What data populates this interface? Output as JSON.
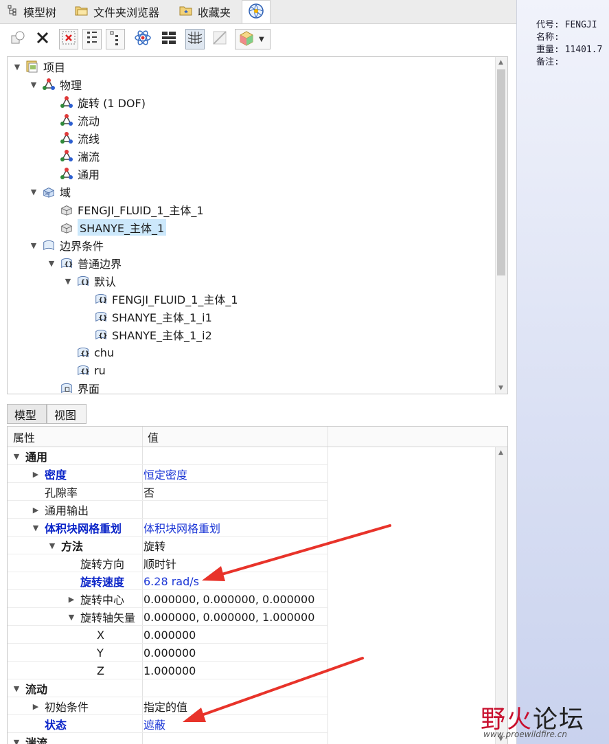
{
  "tabs": [
    {
      "label": "模型树",
      "icon": "model-tree-icon"
    },
    {
      "label": "文件夹浏览器",
      "icon": "folder-browser-icon"
    },
    {
      "label": "收藏夹",
      "icon": "favorites-icon"
    },
    {
      "label": "",
      "icon": "flow-analysis-icon"
    }
  ],
  "tree": {
    "nodes": [
      {
        "label": "项目",
        "icon": "project-icon"
      },
      {
        "label": "物理",
        "icon": "physics-icon"
      },
      {
        "label": "旋转 (1 DOF)",
        "icon": "physics-icon"
      },
      {
        "label": "流动",
        "icon": "physics-icon"
      },
      {
        "label": "流线",
        "icon": "physics-icon"
      },
      {
        "label": "湍流",
        "icon": "physics-icon"
      },
      {
        "label": "通用",
        "icon": "physics-icon"
      },
      {
        "label": "域",
        "icon": "domain-icon"
      },
      {
        "label": "FENGJI_FLUID_1_主体_1",
        "icon": "body-icon"
      },
      {
        "label": "SHANYE_主体_1",
        "icon": "body-icon"
      },
      {
        "label": "边界条件",
        "icon": "boundary-icon"
      },
      {
        "label": "普通边界",
        "icon": "boundary-icon"
      },
      {
        "label": "默认",
        "icon": "boundary-icon"
      },
      {
        "label": "FENGJI_FLUID_1_主体_1",
        "icon": "boundary-icon"
      },
      {
        "label": "SHANYE_主体_1_i1",
        "icon": "boundary-icon"
      },
      {
        "label": "SHANYE_主体_1_i2",
        "icon": "boundary-icon"
      },
      {
        "label": "chu",
        "icon": "boundary-icon"
      },
      {
        "label": "ru",
        "icon": "boundary-icon"
      },
      {
        "label": "界面",
        "icon": "interface-icon"
      }
    ]
  },
  "panel_tabs": [
    "模型",
    "视图"
  ],
  "grid": {
    "headers": {
      "property": "属性",
      "value": "值"
    },
    "rows": [
      {
        "key": "通用",
        "value": ""
      },
      {
        "key": "密度",
        "value": "恒定密度"
      },
      {
        "key": "孔隙率",
        "value": "否"
      },
      {
        "key": "通用输出",
        "value": ""
      },
      {
        "key": "体积块网格重划",
        "value": "体积块网格重划"
      },
      {
        "key": "方法",
        "value": "旋转"
      },
      {
        "key": "旋转方向",
        "value": "顺时针"
      },
      {
        "key": "旋转速度",
        "value": "6.28 rad/s"
      },
      {
        "key": "旋转中心",
        "value": "0.000000, 0.000000, 0.000000"
      },
      {
        "key": "旋转轴矢量",
        "value": "0.000000, 0.000000, 1.000000"
      },
      {
        "key": "X",
        "value": "0.000000"
      },
      {
        "key": "Y",
        "value": "0.000000"
      },
      {
        "key": "Z",
        "value": "1.000000"
      },
      {
        "key": "流动",
        "value": ""
      },
      {
        "key": "初始条件",
        "value": "指定的值"
      },
      {
        "key": "状态",
        "value": "遮蔽"
      },
      {
        "key": "湍流",
        "value": ""
      }
    ]
  },
  "meta": [
    {
      "label": "代号:",
      "value": "FENGJI"
    },
    {
      "label": "名称:",
      "value": ""
    },
    {
      "label": "重量:",
      "value": "11401.7"
    },
    {
      "label": "备注:",
      "value": ""
    }
  ],
  "watermark": {
    "title_a": "野火",
    "title_b": "论坛",
    "url": "www.proewildfire.cn"
  },
  "colors": {
    "accent_blue": "#0a24c8",
    "selection": "#cce8fb",
    "arrow": "#e8332a"
  }
}
